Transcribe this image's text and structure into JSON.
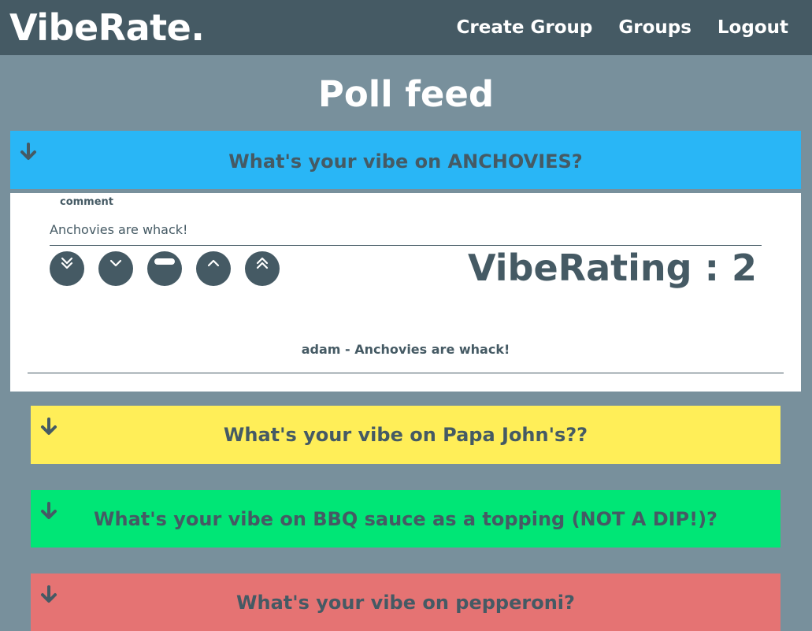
{
  "navbar": {
    "brand": "VibeRate.",
    "links": [
      {
        "label": "Create Group"
      },
      {
        "label": "Groups"
      },
      {
        "label": "Logout"
      }
    ]
  },
  "page": {
    "title": "Poll feed"
  },
  "polls": [
    {
      "question": "What's your vibe on ANCHOVIES?",
      "color": "#29b6f6",
      "expanded": true,
      "comment_label": "comment",
      "comment_value": "Anchovies are whack!",
      "rating_label": "VibeRating : 2",
      "vote_buttons": [
        "double-chevron-down-icon",
        "chevron-down-icon",
        "minus-icon",
        "chevron-up-icon",
        "double-chevron-up-icon"
      ],
      "comments": [
        {
          "text": "adam - Anchovies are whack!"
        }
      ]
    },
    {
      "question": "What's your vibe on Papa John's??",
      "color": "#ffee58",
      "expanded": false
    },
    {
      "question": "What's your vibe on BBQ sauce as a topping (NOT A DIP!)?",
      "color": "#00e676",
      "expanded": false
    },
    {
      "question": "What's your vibe on pepperoni?",
      "color": "#e57373",
      "expanded": false
    }
  ],
  "colors": {
    "navbar_bg": "#455a64",
    "page_bg": "#78909c",
    "text": "#455a64"
  }
}
